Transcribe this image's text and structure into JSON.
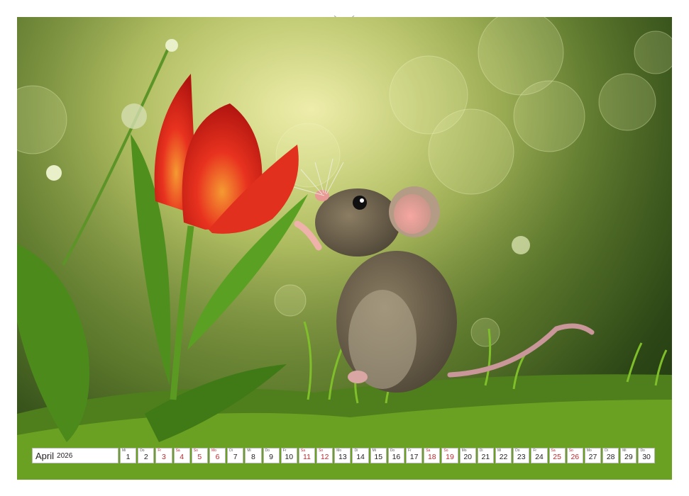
{
  "calendar": {
    "month": "April",
    "year": "2026",
    "days": [
      {
        "wd": "Mi",
        "d": "1",
        "red": false
      },
      {
        "wd": "Do",
        "d": "2",
        "red": false
      },
      {
        "wd": "Fr",
        "d": "3",
        "red": true
      },
      {
        "wd": "Sa",
        "d": "4",
        "red": true
      },
      {
        "wd": "So",
        "d": "5",
        "red": true
      },
      {
        "wd": "Mo",
        "d": "6",
        "red": true
      },
      {
        "wd": "Di",
        "d": "7",
        "red": false
      },
      {
        "wd": "Mi",
        "d": "8",
        "red": false
      },
      {
        "wd": "Do",
        "d": "9",
        "red": false
      },
      {
        "wd": "Fr",
        "d": "10",
        "red": false
      },
      {
        "wd": "Sa",
        "d": "11",
        "red": true
      },
      {
        "wd": "So",
        "d": "12",
        "red": true
      },
      {
        "wd": "Mo",
        "d": "13",
        "red": false
      },
      {
        "wd": "Di",
        "d": "14",
        "red": false
      },
      {
        "wd": "Mi",
        "d": "15",
        "red": false
      },
      {
        "wd": "Do",
        "d": "16",
        "red": false
      },
      {
        "wd": "Fr",
        "d": "17",
        "red": false
      },
      {
        "wd": "Sa",
        "d": "18",
        "red": true
      },
      {
        "wd": "So",
        "d": "19",
        "red": true
      },
      {
        "wd": "Mo",
        "d": "20",
        "red": false
      },
      {
        "wd": "Di",
        "d": "21",
        "red": false
      },
      {
        "wd": "Mi",
        "d": "22",
        "red": false
      },
      {
        "wd": "Do",
        "d": "23",
        "red": false
      },
      {
        "wd": "Fr",
        "d": "24",
        "red": false
      },
      {
        "wd": "Sa",
        "d": "25",
        "red": true
      },
      {
        "wd": "So",
        "d": "26",
        "red": true
      },
      {
        "wd": "Mo",
        "d": "27",
        "red": false
      },
      {
        "wd": "Di",
        "d": "28",
        "red": false
      },
      {
        "wd": "Mi",
        "d": "29",
        "red": false
      },
      {
        "wd": "Do",
        "d": "30",
        "red": false
      }
    ]
  },
  "colors": {
    "weekend_red": "#c0282d",
    "tulip": "#e02a1f",
    "grass": "#5f9a1d"
  },
  "icons": [
    "spiral-binding-icon",
    "hanger-hole-icon"
  ]
}
